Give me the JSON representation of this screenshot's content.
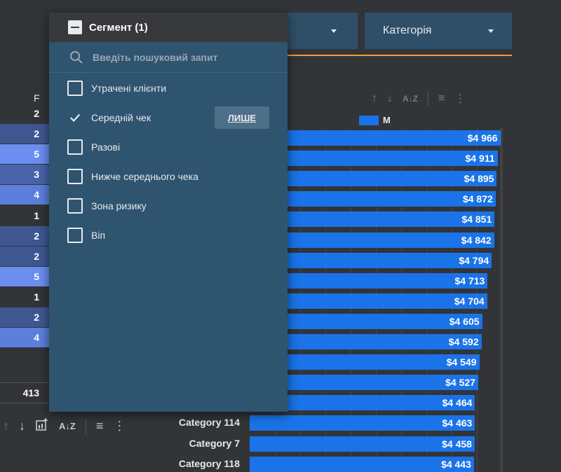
{
  "top_filters": {
    "first": {
      "label": ""
    },
    "second": {
      "label": "Категорія"
    }
  },
  "legend": {
    "label": "M",
    "color": "#1a73e8"
  },
  "left_table": {
    "header": "F",
    "cells": [
      {
        "value": "2",
        "color": "#323437"
      },
      {
        "value": "2",
        "color": "#3e5791"
      },
      {
        "value": "5",
        "color": "#6b8ef0"
      },
      {
        "value": "3",
        "color": "#4a64aa"
      },
      {
        "value": "4",
        "color": "#5c7fdc"
      },
      {
        "value": "1",
        "color": "#323437"
      },
      {
        "value": "2",
        "color": "#3e5791"
      },
      {
        "value": "2",
        "color": "#3e5791"
      },
      {
        "value": "5",
        "color": "#6b8ef0"
      },
      {
        "value": "1",
        "color": "#323437"
      },
      {
        "value": "2",
        "color": "#3e5791"
      },
      {
        "value": "4",
        "color": "#5c7fdc"
      }
    ],
    "total": "413"
  },
  "segment_filter": {
    "title": "Сегмент (1)",
    "search_placeholder": "Введіть пошуковий запит",
    "only_label": "ЛИШЕ",
    "options": [
      {
        "label": "Утрачені клієнти",
        "checked": false
      },
      {
        "label": "Середній чек",
        "checked": true
      },
      {
        "label": "Разові",
        "checked": false
      },
      {
        "label": "Нижче середнього чека",
        "checked": false
      },
      {
        "label": "Зона ризику",
        "checked": false
      },
      {
        "label": "Віп",
        "checked": false
      }
    ]
  },
  "chart_data": {
    "type": "bar",
    "orientation": "horizontal",
    "categories": [
      "",
      "",
      "",
      "",
      "",
      "",
      "",
      "",
      "",
      "",
      "",
      "",
      "",
      "",
      "Category 114",
      "Category 7",
      "Category 118"
    ],
    "series": [
      {
        "name": "M",
        "values": [
          4966,
          4911,
          4895,
          4872,
          4851,
          4842,
          4794,
          4713,
          4704,
          4605,
          4592,
          4549,
          4527,
          4464,
          4463,
          4458,
          4443
        ],
        "labels": [
          "$4 966",
          "$4 911",
          "$4 895",
          "$4 872",
          "$4 851",
          "$4 842",
          "$4 794",
          "$4 713",
          "$4 704",
          "$4 605",
          "$4 592",
          "$4 549",
          "$4 527",
          "$4 464",
          "$4 463",
          "$4 458",
          "$4 443"
        ]
      }
    ],
    "xlim": [
      0,
      5000
    ],
    "grid": true,
    "legend_position": "top"
  }
}
